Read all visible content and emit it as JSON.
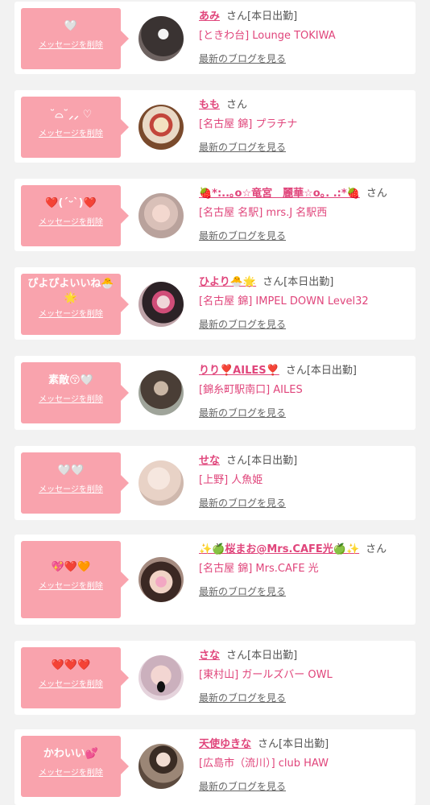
{
  "delete_label": "メッセージを削除",
  "blog_label": "最新のブログを見る",
  "items": [
    {
      "message": "🤍",
      "name": "あみ",
      "suffix": "さん[本日出勤]",
      "shop": "[ときわ台] Lounge TOKIWA"
    },
    {
      "message": "˘⌓˘⸝⸝ ♡",
      "name": "もも",
      "suffix": "さん",
      "shop": "[名古屋 錦] プラチナ"
    },
    {
      "message": "❤️(ˊᵕˋ)❤️",
      "name": "🍓*:..｡o☆竜宮　麗華☆o｡. .:*🍓",
      "suffix": "さん",
      "shop": "[名古屋 名駅] mrs.J 名駅西"
    },
    {
      "message": "ぴよぴよいいね🐣🌟",
      "name": "ひより🐣🌟",
      "suffix": "さん[本日出勤]",
      "shop": "[名古屋 錦] IMPEL DOWN Level32"
    },
    {
      "message": "素敵😚🤍",
      "name": "りり❣️AILES❣️",
      "suffix": "さん[本日出勤]",
      "shop": "[錦糸町駅南口] AILES"
    },
    {
      "message": "🤍🤍",
      "name": "せな",
      "suffix": "さん[本日出勤]",
      "shop": "[上野] 人魚姫"
    },
    {
      "message": "💖❤️🧡",
      "name": "✨🍏桜まお@Mrs.CAFE光🍏✨",
      "suffix": "さん",
      "shop": "[名古屋 錦] Mrs.CAFE 光"
    },
    {
      "message": "❤️❤️❤️",
      "name": "さな",
      "suffix": "さん[本日出勤]",
      "shop": "[東村山] ガールズバー OWL"
    },
    {
      "message": "かわいい💕",
      "name": "天使ゆきな",
      "suffix": "さん[本日出勤]",
      "shop": "[広島市（流川）] club HAW"
    }
  ],
  "colors": {
    "bubble": "#f9a3ad",
    "name": "#e0457b",
    "background": "#f2f2f2"
  }
}
